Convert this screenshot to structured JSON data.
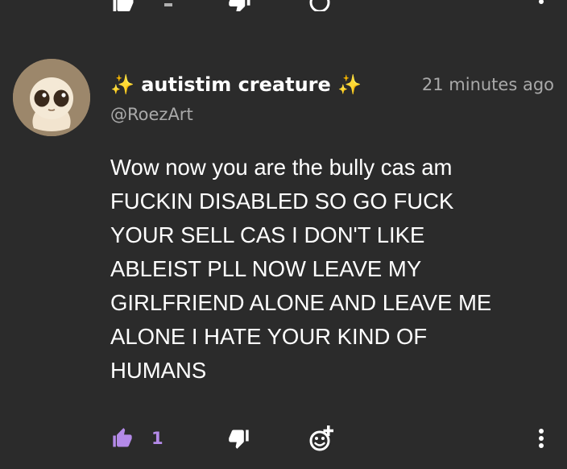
{
  "comment": {
    "display_name": "✨ autistim creature ✨",
    "handle": "@RoezArt",
    "timestamp": "21 minutes ago",
    "text": "Wow now you are the bully cas am\nFUCKIN DISABLED SO GO FUCK\nYOUR SELL CAS I DON'T LIKE\nABLEIST PLL NOW LEAVE MY\nGIRLFRIEND ALONE AND LEAVE ME\nALONE I HATE YOUR KIND OF\nHUMANS",
    "likes": "1"
  },
  "icons": {
    "like": "thumbs-up-icon",
    "dislike": "thumbs-down-icon",
    "react": "add-reaction-icon",
    "more": "more-vertical-icon"
  },
  "colors": {
    "background": "#2b2b2b",
    "accent": "#b48ae8",
    "muted_text": "#a9a9a9",
    "text": "#ffffff"
  }
}
